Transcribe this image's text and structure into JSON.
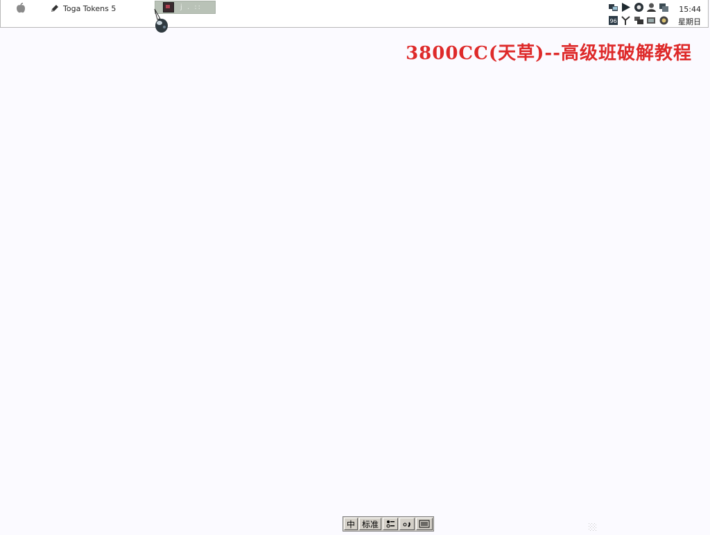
{
  "taskbar": {
    "apple_menu_icon": "apple-logo-icon",
    "task_items": [
      {
        "label": "Toga Tokens 5",
        "icon": "pencil-icon"
      }
    ],
    "active_task": {
      "label": "j . ::",
      "icon": "window-thumbnail-icon"
    }
  },
  "tray": {
    "icons_row1": [
      "network-icon",
      "play-icon",
      "gear-circle-icon",
      "globe-person-icon",
      "monitor-icon"
    ],
    "icons_row2": [
      "qq-icon",
      "tools-icon",
      "chat-icon",
      "speaker-icon",
      "security-icon"
    ]
  },
  "clock": {
    "time": "15:44",
    "day": "星期日"
  },
  "watermark": {
    "text": "3800CC(天草)--高级班破解教程",
    "color": "#de2a2a"
  },
  "ime": {
    "mode": "中",
    "layout": "标准",
    "buttons": [
      "punctuation-icon",
      "fullwidth-icon",
      "soft-keyboard-icon"
    ]
  }
}
